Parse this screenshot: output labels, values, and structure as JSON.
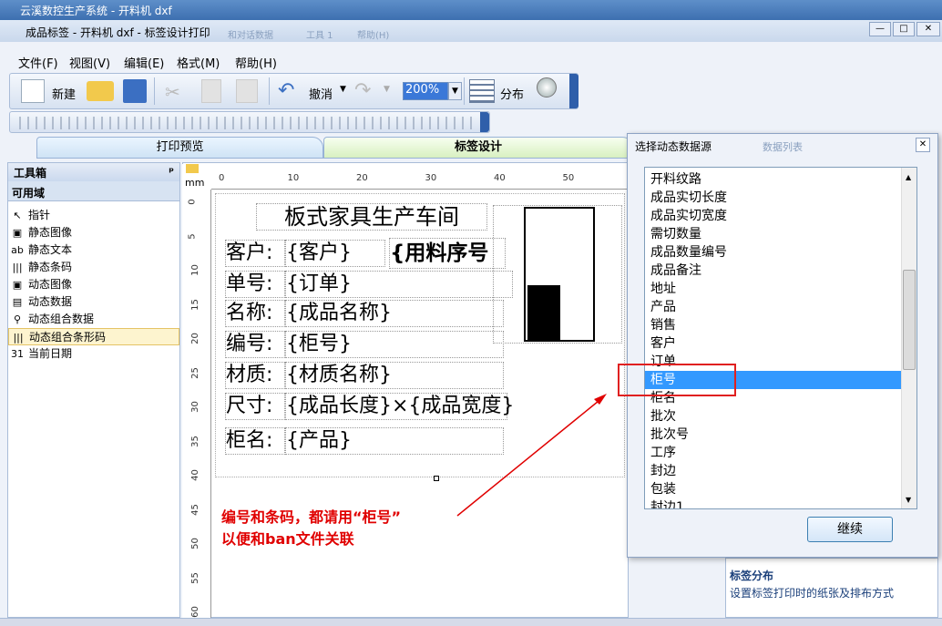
{
  "outer_title": "云溪数控生产系统 - 开料机 dxf",
  "inner_title": "成品标签 - 开料机 dxf - 标签设计打印",
  "inner_title_blurred": [
    "和对话数据",
    "工具 1",
    "帮助(H)"
  ],
  "window_buttons": [
    "—",
    "□",
    "✕"
  ],
  "menu": [
    "文件(F)",
    "视图(V)",
    "编辑(E)",
    "格式(M)",
    "帮助(H)"
  ],
  "toolbar": {
    "new": "新建",
    "undo": "撤消",
    "zoom": "200%",
    "distribute": "分布"
  },
  "tabs": {
    "preview": "打印预览",
    "design": "标签设计"
  },
  "toolbox": {
    "title": "工具箱",
    "section": "可用域",
    "items": [
      {
        "icon": "pointer-icon",
        "glyph": "↖",
        "label": "指针"
      },
      {
        "icon": "image-icon",
        "glyph": "▣",
        "label": "静态图像"
      },
      {
        "icon": "text-icon",
        "glyph": "ab",
        "label": "静态文本"
      },
      {
        "icon": "barcode-icon",
        "glyph": "|||",
        "label": "静态条码"
      },
      {
        "icon": "image-icon",
        "glyph": "▣",
        "label": "动态图像"
      },
      {
        "icon": "data-icon",
        "glyph": "▤",
        "label": "动态数据"
      },
      {
        "icon": "combo-data-icon",
        "glyph": "⚲",
        "label": "动态组合数据"
      },
      {
        "icon": "barcode-icon",
        "glyph": "|||",
        "label": "动态组合条形码"
      },
      {
        "icon": "calendar-icon",
        "glyph": "31",
        "label": "当前日期"
      }
    ]
  },
  "ruler": {
    "unit": "mm",
    "h_ticks": [
      "0",
      "10",
      "20",
      "30",
      "40",
      "50"
    ],
    "v_ticks": [
      "0",
      "5",
      "10",
      "15",
      "20",
      "25",
      "30",
      "35",
      "40",
      "45",
      "50",
      "55",
      "60"
    ]
  },
  "label": {
    "title": "板式家具生产车间",
    "seq": "{用料序号",
    "rows": [
      {
        "k": "客户:",
        "v": "{客户}"
      },
      {
        "k": "单号:",
        "v": "{订单}"
      },
      {
        "k": "名称:",
        "v": "{成品名称}"
      },
      {
        "k": "编号:",
        "v": "{柜号}"
      },
      {
        "k": "材质:",
        "v": "{材质名称}"
      },
      {
        "k": "尺寸:",
        "v": "{成品长度}×{成品宽度}"
      },
      {
        "k": "柜名:",
        "v": "{产品}"
      }
    ]
  },
  "dialog": {
    "title": "选择动态数据源",
    "behind": "数据列表",
    "items": [
      "开料纹路",
      "成品实切长度",
      "成品实切宽度",
      "需切数量",
      "成品数量编号",
      "成品备注",
      "地址",
      "产品",
      "销售",
      "客户",
      "订单",
      "柜号",
      "柜名",
      "批次",
      "批次号",
      "工序",
      "封边",
      "包装",
      "封边1"
    ],
    "selected_index": 11,
    "continue": "继续"
  },
  "right_panel": {
    "title": "标签分布",
    "desc": "设置标签打印时的纸张及排布方式"
  },
  "annotation": [
    "编号和条码，都请用“柜号”",
    "以便和ban文件关联"
  ],
  "colors": {
    "accent": "#3399ff",
    "note": "#e00000"
  }
}
